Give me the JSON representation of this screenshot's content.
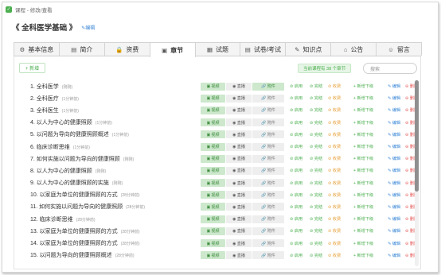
{
  "window": {
    "breadcrumb": "课程 - 修改/查看"
  },
  "course": {
    "title": "《 全科医学基础 》",
    "edit_label": "✎编辑"
  },
  "tabs": [
    {
      "icon": "⚙",
      "label": "基本信息"
    },
    {
      "icon": "▤",
      "label": "简介"
    },
    {
      "icon": "🔒",
      "label": "资费"
    },
    {
      "icon": "▣",
      "label": "章节",
      "active": true
    },
    {
      "icon": "▦",
      "label": "试题"
    },
    {
      "icon": "▤",
      "label": "试卷/考试"
    },
    {
      "icon": "✎",
      "label": "知识点"
    },
    {
      "icon": "⌂",
      "label": "公告"
    },
    {
      "icon": "☺",
      "label": "留言"
    }
  ],
  "toolbar": {
    "add_label": "+ 新增",
    "count_label": "当前课程有 38 个章节",
    "search_placeholder": "搜索"
  },
  "chip_labels": {
    "video": "▣ 视频",
    "live": "◉ 直播",
    "attach": "🔗 附件"
  },
  "action_labels": {
    "enable": "⊘ 启用",
    "done": "⊘ 完结",
    "charge": "⊘ 收费",
    "add_sub": "+ 新增下级",
    "edit": "✎ 编辑",
    "delete": "⊖ 删除"
  },
  "chapters": [
    {
      "title": "1. 全科医学",
      "duration": "(刚刚)",
      "attach_on": true
    },
    {
      "title": "2. 全科医疗",
      "duration": "(1分钟前)",
      "attach_on": false
    },
    {
      "title": "3. 全科医生",
      "duration": "(1分钟前)",
      "attach_on": false
    },
    {
      "title": "4. 以人为中心的健康照顾",
      "duration": "(1分钟前)",
      "attach_on": false
    },
    {
      "title": "5. 以问题为导向的健康照顾概述",
      "duration": "(1分钟前)",
      "attach_on": false
    },
    {
      "title": "6. 临床诊断思维",
      "duration": "(1分钟前)",
      "attach_on": false
    },
    {
      "title": "7. 如何实施以问题为导向的健康照顾",
      "duration": "(刚刚)",
      "attach_on": false
    },
    {
      "title": "8. 以人为中心的健康照顾",
      "duration": "(刚刚)",
      "attach_on": false
    },
    {
      "title": "9. 以人为中心的健康照顾的实施",
      "duration": "(刚刚)",
      "attach_on": false
    },
    {
      "title": "10. 以家庭为单位的健康照顾的方式",
      "duration": "(28分钟前)",
      "attach_on": false
    },
    {
      "title": "11. 如何实施以问题为导向的健康照顾",
      "duration": "(28分钟前)",
      "attach_on": false
    },
    {
      "title": "12. 临床诊断思维",
      "duration": "(28分钟前)",
      "attach_on": false
    },
    {
      "title": "13. 以家庭为单位的健康照顾的方式",
      "duration": "(28分钟前)",
      "attach_on": false
    },
    {
      "title": "14. 以家庭为单位的健康照顾的方式",
      "duration": "(28分钟前)",
      "attach_on": false
    },
    {
      "title": "15. 以问题为导向的健康照顾概述",
      "duration": "(28分钟前)",
      "attach_on": false
    }
  ],
  "colors": {
    "accent_green": "#4caf50",
    "link_blue": "#3a87d6",
    "danger_red": "#e55353",
    "warning_orange": "#e6a23c"
  }
}
